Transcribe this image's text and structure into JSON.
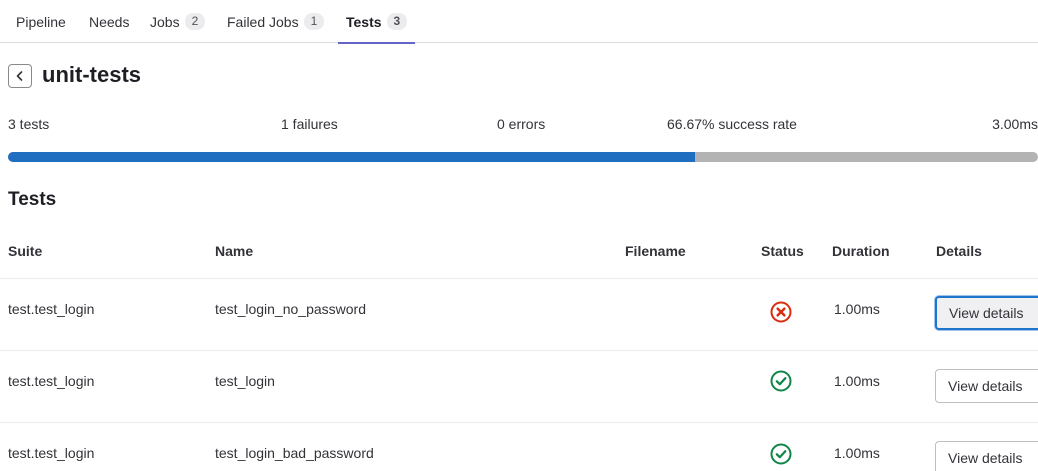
{
  "tabs": [
    {
      "label": "Pipeline",
      "count": null
    },
    {
      "label": "Needs",
      "count": null
    },
    {
      "label": "Jobs",
      "count": "2"
    },
    {
      "label": "Failed Jobs",
      "count": "1"
    },
    {
      "label": "Tests",
      "count": "3"
    }
  ],
  "active_tab": "Tests",
  "suite": {
    "name": "unit-tests"
  },
  "summary": {
    "tests": "3 tests",
    "failures": "1 failures",
    "errors": "0 errors",
    "success_rate": "66.67% success rate",
    "duration": "3.00ms",
    "success_fraction": 0.6667
  },
  "colors": {
    "success_bar": "#1f6ebf",
    "remaining_bar": "#b3b3b3",
    "failed": "#dd2b0e",
    "passed": "#108548",
    "tab_underline": "#6366c7"
  },
  "section_title": "Tests",
  "table": {
    "headers": {
      "suite": "Suite",
      "name": "Name",
      "filename": "Filename",
      "status": "Status",
      "duration": "Duration",
      "details": "Details"
    },
    "rows": [
      {
        "suite": "test.test_login",
        "name": "test_login_no_password",
        "filename": "",
        "status": "failed",
        "status_icon": "status-failed-icon",
        "duration": "1.00ms",
        "details_label": "View details"
      },
      {
        "suite": "test.test_login",
        "name": "test_login",
        "filename": "",
        "status": "success",
        "status_icon": "status-success-icon",
        "duration": "1.00ms",
        "details_label": "View details"
      },
      {
        "suite": "test.test_login",
        "name": "test_login_bad_password",
        "filename": "",
        "status": "success",
        "status_icon": "status-success-icon",
        "duration": "1.00ms",
        "details_label": "View details"
      }
    ]
  }
}
